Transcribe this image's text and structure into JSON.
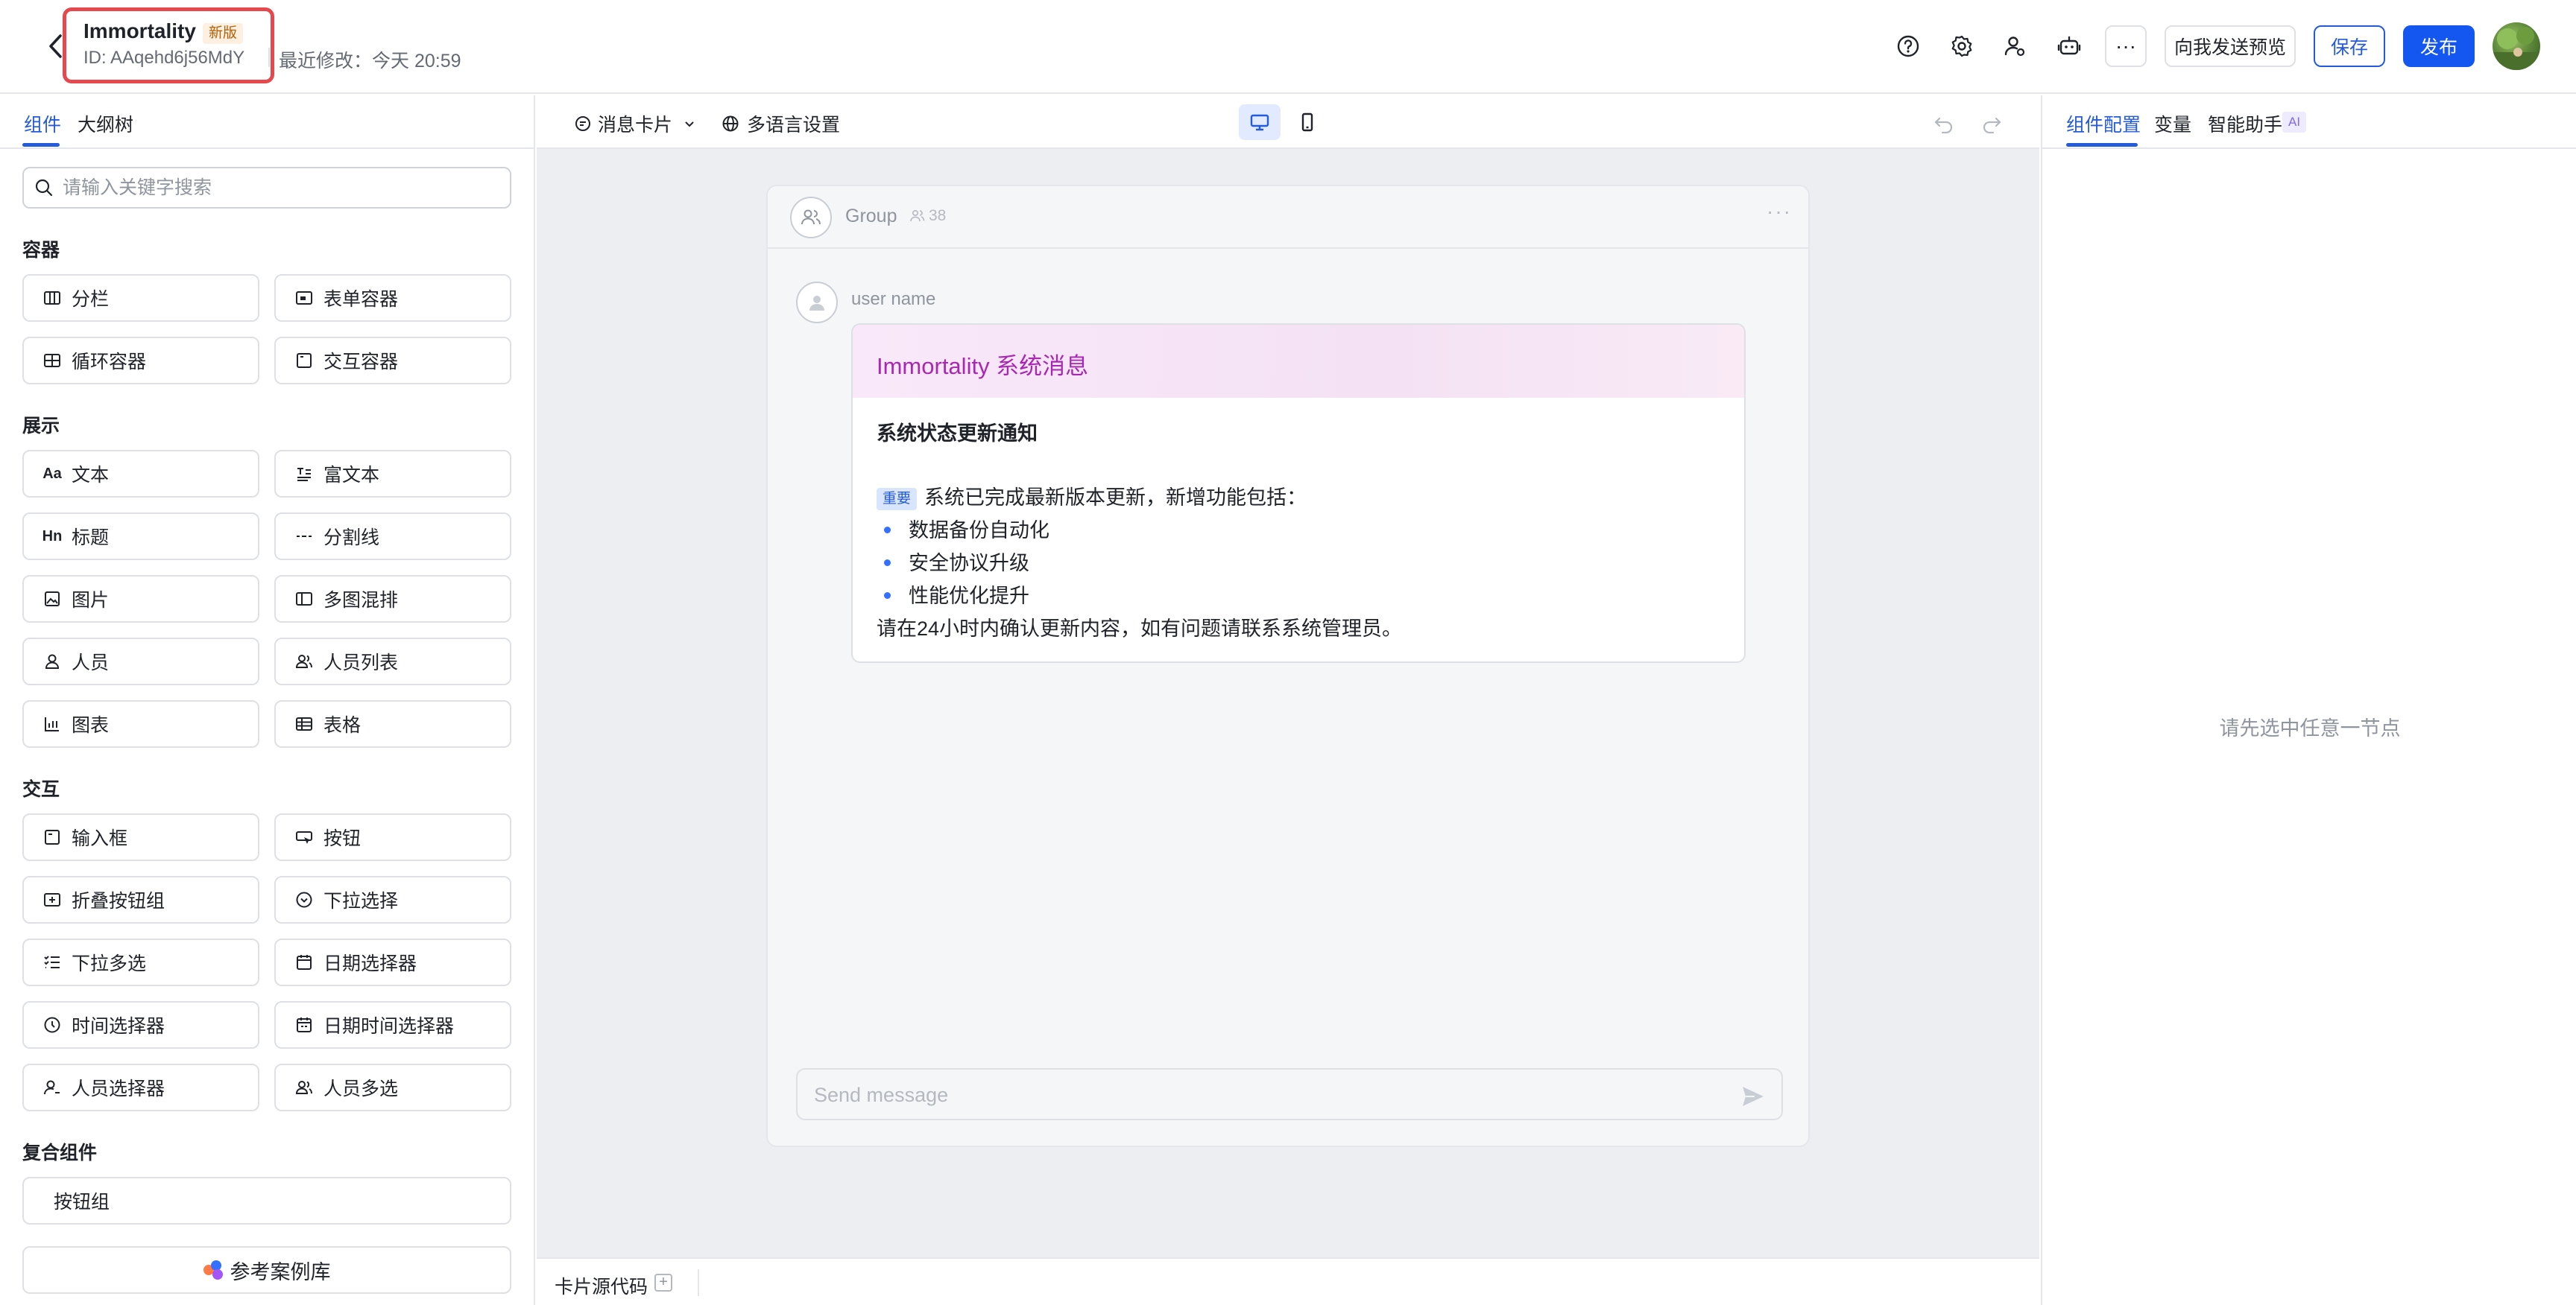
{
  "header": {
    "app_name": "Immortality",
    "new_badge": "新版",
    "app_id": "ID: AAqehd6j56MdY",
    "last_modified": "最近修改：今天 20:59",
    "preview_label": "向我发送预览",
    "save_label": "保存",
    "publish_label": "发布",
    "more_label": "···"
  },
  "left_panel": {
    "tabs": [
      "组件",
      "大纲树"
    ],
    "search_placeholder": "请输入关键字搜索",
    "sections": {
      "container": {
        "title": "容器",
        "items": [
          "分栏",
          "表单容器",
          "循环容器",
          "交互容器"
        ]
      },
      "display": {
        "title": "展示",
        "items": [
          "文本",
          "富文本",
          "标题",
          "分割线",
          "图片",
          "多图混排",
          "人员",
          "人员列表",
          "图表",
          "表格"
        ]
      },
      "interaction": {
        "title": "交互",
        "items": [
          "输入框",
          "按钮",
          "折叠按钮组",
          "下拉选择",
          "下拉多选",
          "日期选择器",
          "时间选择器",
          "日期时间选择器",
          "人员选择器",
          "人员多选"
        ]
      },
      "composite": {
        "title": "复合组件",
        "items": [
          "按钮组"
        ]
      }
    },
    "reference_library": "参考案例库"
  },
  "center": {
    "toolbar": {
      "card_type": "消息卡片",
      "i18n_settings": "多语言设置"
    },
    "preview": {
      "group_name": "Group",
      "member_count": "38",
      "user_name": "user name",
      "card": {
        "title": "Immortality 系统消息",
        "subtitle": "系统状态更新通知",
        "tag": "重要",
        "intro": "系统已完成最新版本更新，新增功能包括：",
        "bullets": [
          "数据备份自动化",
          "安全协议升级",
          "性能优化提升"
        ],
        "footer": "请在24小时内确认更新内容，如有问题请联系系统管理员。"
      },
      "send_placeholder": "Send message"
    },
    "bottom": {
      "source_code_label": "卡片源代码"
    }
  },
  "right_panel": {
    "tabs": [
      "组件配置",
      "变量",
      "智能助手"
    ],
    "ai_badge": "AI",
    "empty_hint": "请先选中任意一节点"
  },
  "colors": {
    "primary": "#1456f0",
    "accent_text": "#245bdb",
    "card_title": "#a828b2",
    "highlight_box": "#e5484d"
  }
}
